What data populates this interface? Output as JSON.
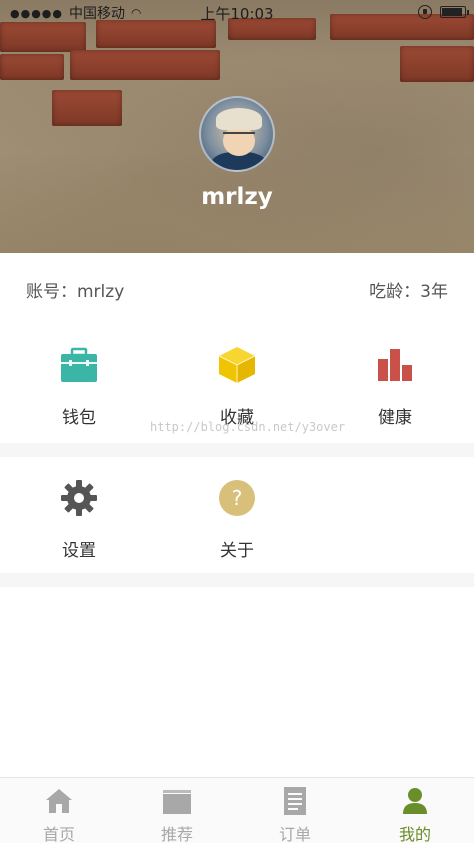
{
  "status_bar": {
    "signal_dots": "●●●●●",
    "carrier": "中国移动",
    "time": "上午10:03"
  },
  "profile": {
    "username": "mrlzy"
  },
  "account": {
    "account_label": "账号：mrlzy",
    "age_label": "吃龄：3年"
  },
  "grid": {
    "items": [
      {
        "label": "钱包",
        "icon": "wallet-icon",
        "color": "#3bb5a6"
      },
      {
        "label": "收藏",
        "icon": "cube-icon",
        "color": "#f2c800"
      },
      {
        "label": "健康",
        "icon": "bar-chart-icon",
        "color": "#c9514a"
      },
      {
        "label": "设置",
        "icon": "gear-icon",
        "color": "#555555"
      },
      {
        "label": "关于",
        "icon": "question-icon",
        "color": "#d8c07a"
      }
    ]
  },
  "watermark": "http://blog.csdn.net/y3over",
  "tabbar": {
    "tabs": [
      {
        "label": "首页",
        "icon": "home-icon",
        "active": false
      },
      {
        "label": "推荐",
        "icon": "recommend-icon",
        "active": false
      },
      {
        "label": "订单",
        "icon": "order-icon",
        "active": false
      },
      {
        "label": "我的",
        "icon": "person-icon",
        "active": true
      }
    ],
    "active_color": "#6a8e2a",
    "inactive_color": "#a8a8a8"
  }
}
